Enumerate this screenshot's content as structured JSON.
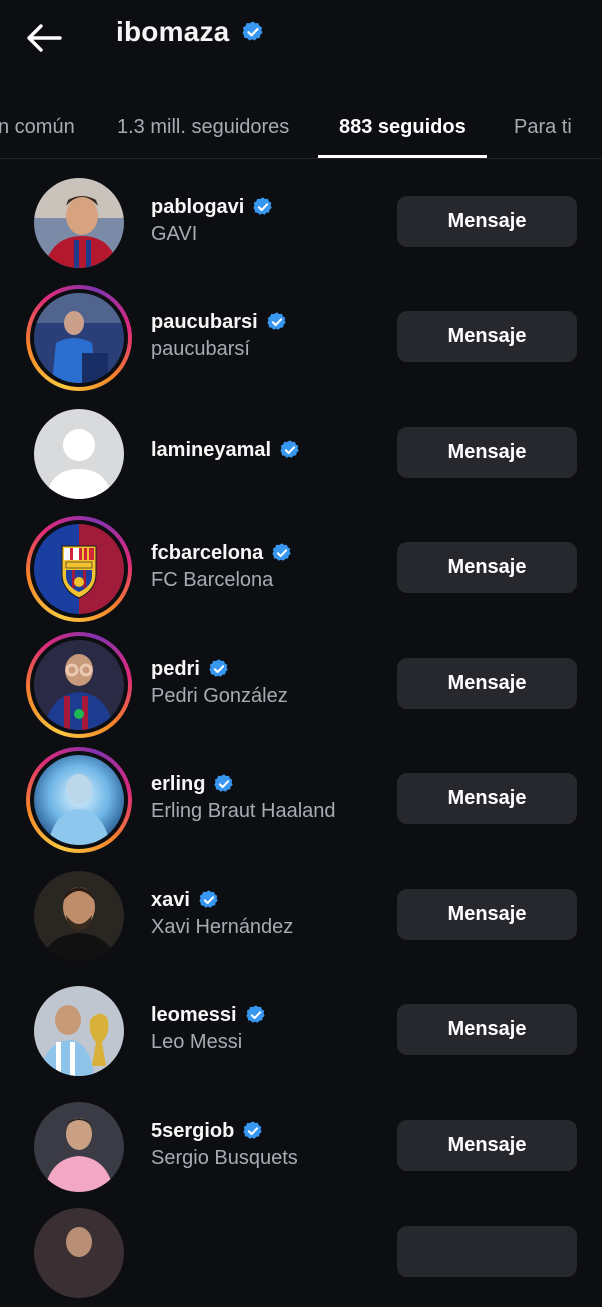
{
  "header": {
    "title": "ibomaza",
    "back_icon": "arrow-left-icon",
    "verified_icon": "verified-badge-icon",
    "verified_color": "#3897f0"
  },
  "tabs": [
    {
      "label": "n común",
      "active": false
    },
    {
      "label": "1.3 mill. seguidores",
      "active": false
    },
    {
      "label": "883 seguidos",
      "active": true
    },
    {
      "label": "Para ti",
      "active": false
    }
  ],
  "button_label": "Mensaje",
  "accounts": [
    {
      "username": "pablogavi",
      "full_name": "GAVI",
      "verified": true,
      "story_ring": false
    },
    {
      "username": "paucubarsi",
      "full_name": "paucubarsí",
      "verified": true,
      "story_ring": true
    },
    {
      "username": "lamineyamal",
      "full_name": "",
      "verified": true,
      "story_ring": false
    },
    {
      "username": "fcbarcelona",
      "full_name": "FC Barcelona",
      "verified": true,
      "story_ring": true
    },
    {
      "username": "pedri",
      "full_name": "Pedri González",
      "verified": true,
      "story_ring": true
    },
    {
      "username": "erling",
      "full_name": "Erling Braut Haaland",
      "verified": true,
      "story_ring": true
    },
    {
      "username": "xavi",
      "full_name": "Xavi Hernández",
      "verified": true,
      "story_ring": false
    },
    {
      "username": "leomessi",
      "full_name": "Leo Messi",
      "verified": true,
      "story_ring": false
    },
    {
      "username": "5sergiob",
      "full_name": "Sergio Busquets",
      "verified": true,
      "story_ring": false
    }
  ],
  "colors": {
    "background": "#0d0e12",
    "button": "#26282e",
    "secondary_text": "#a7abb3"
  }
}
